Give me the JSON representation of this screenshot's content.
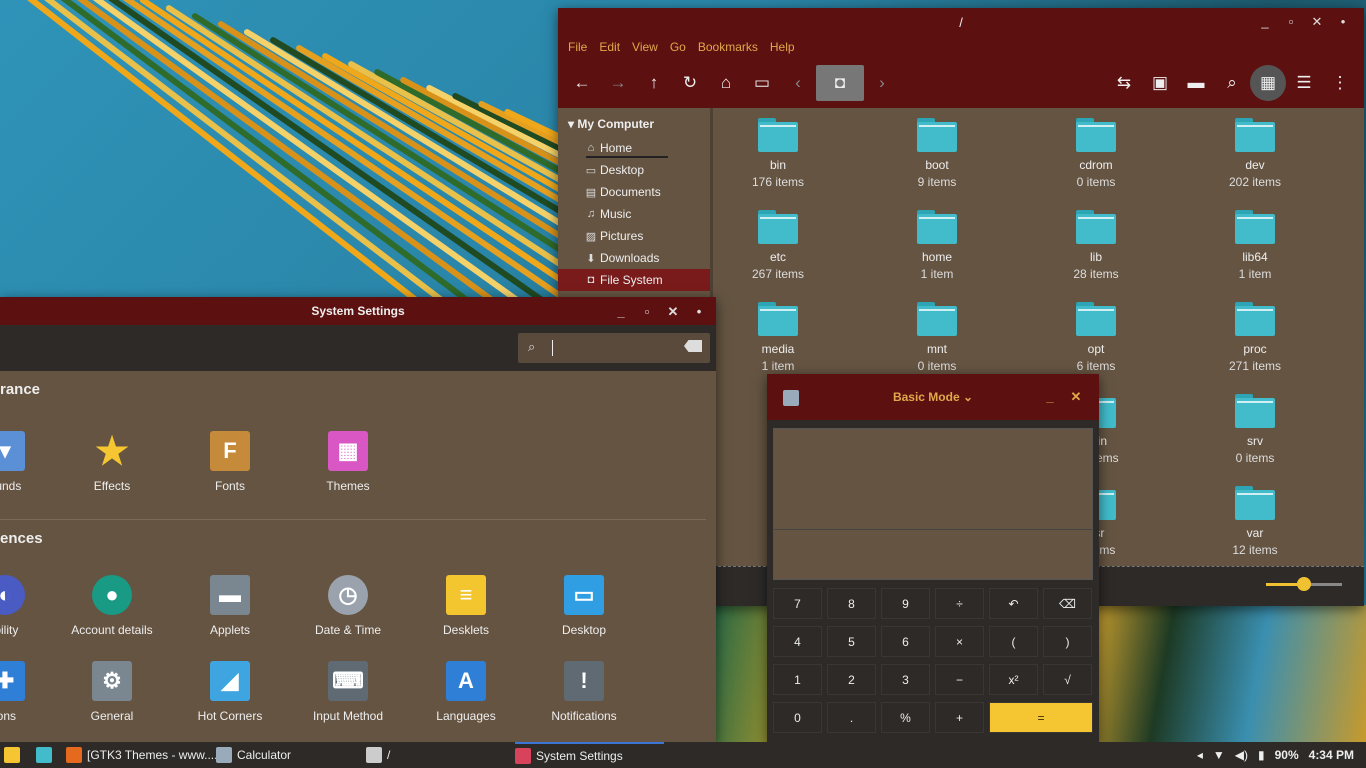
{
  "nemo": {
    "title": "/",
    "menu": [
      "File",
      "Edit",
      "View",
      "Go",
      "Bookmarks",
      "Help"
    ],
    "sidebar": {
      "header": "My Computer",
      "items": [
        {
          "label": "Home",
          "icon": "home-icon",
          "glyph": "⌂"
        },
        {
          "label": "Desktop",
          "icon": "desktop-icon",
          "glyph": "▭"
        },
        {
          "label": "Documents",
          "icon": "documents-icon",
          "glyph": "▤"
        },
        {
          "label": "Music",
          "icon": "music-icon",
          "glyph": "♫"
        },
        {
          "label": "Pictures",
          "icon": "pictures-icon",
          "glyph": "▨"
        },
        {
          "label": "Downloads",
          "icon": "downloads-icon",
          "glyph": "⬇"
        },
        {
          "label": "File System",
          "icon": "filesystem-icon",
          "glyph": "◘"
        }
      ]
    },
    "folders": [
      {
        "name": "bin",
        "count": "176 items"
      },
      {
        "name": "boot",
        "count": "9 items"
      },
      {
        "name": "cdrom",
        "count": "0 items"
      },
      {
        "name": "dev",
        "count": "202 items"
      },
      {
        "name": "etc",
        "count": "267 items"
      },
      {
        "name": "home",
        "count": "1 item"
      },
      {
        "name": "lib",
        "count": "28 items"
      },
      {
        "name": "lib64",
        "count": "1 item"
      },
      {
        "name": "media",
        "count": "1 item"
      },
      {
        "name": "mnt",
        "count": "0 items"
      },
      {
        "name": "opt",
        "count": "6 items"
      },
      {
        "name": "proc",
        "count": "271 items"
      },
      {
        "name": "",
        "count": ""
      },
      {
        "name": "",
        "count": ""
      },
      {
        "name": "sbin",
        "count": "92 items"
      },
      {
        "name": "srv",
        "count": "0 items"
      },
      {
        "name": "",
        "count": ""
      },
      {
        "name": "",
        "count": ""
      },
      {
        "name": "usr",
        "count": "8 items"
      },
      {
        "name": "var",
        "count": "12 items"
      }
    ],
    "zoom_level": 0.5
  },
  "settings": {
    "title": "System Settings",
    "sections": [
      "rance",
      "ences"
    ],
    "appearance": [
      {
        "label": "ounds",
        "icon": "backgrounds-icon",
        "glyph": "▾",
        "color": "#5b8fd6"
      },
      {
        "label": "Effects",
        "icon": "effects-star-icon",
        "glyph": "★",
        "color": "transparent"
      },
      {
        "label": "Fonts",
        "icon": "fonts-icon",
        "glyph": "F",
        "color": "#c58a3a"
      },
      {
        "label": "Themes",
        "icon": "themes-icon",
        "glyph": "▦",
        "color": "#d857c4"
      }
    ],
    "preferences_row1": [
      {
        "label": "ibility",
        "icon": "accessibility-icon",
        "glyph": "◐",
        "color": "#4a5bc4"
      },
      {
        "label": "Account details",
        "icon": "account-icon",
        "glyph": "●",
        "color": "#189a84"
      },
      {
        "label": "Applets",
        "icon": "applets-icon",
        "glyph": "▬",
        "color": "#7a8791"
      },
      {
        "label": "Date & Time",
        "icon": "clock-icon",
        "glyph": "◷",
        "color": "#9aa3ad"
      },
      {
        "label": "Desklets",
        "icon": "desklets-icon",
        "glyph": "≡",
        "color": "#f3c52e"
      },
      {
        "label": "Desktop",
        "icon": "desktop-icon",
        "glyph": "▭",
        "color": "#2f9ee3"
      }
    ],
    "preferences_row2": [
      {
        "label": "ions",
        "icon": "extensions-icon",
        "glyph": "✚",
        "color": "#2f7fd6"
      },
      {
        "label": "General",
        "icon": "gear-icon",
        "glyph": "⚙",
        "color": "#7a8791"
      },
      {
        "label": "Hot Corners",
        "icon": "hot-corners-icon",
        "glyph": "◢",
        "color": "#3fa5e0"
      },
      {
        "label": "Input Method",
        "icon": "keyboard-icon",
        "glyph": "⌨",
        "color": "#5f6a73"
      },
      {
        "label": "Languages",
        "icon": "languages-icon",
        "glyph": "A",
        "color": "#2f7fd6"
      },
      {
        "label": "Notifications",
        "icon": "notifications-icon",
        "glyph": "!",
        "color": "#5f6a73"
      }
    ]
  },
  "calculator": {
    "title": "Basic Mode",
    "keys": [
      [
        "7",
        "8",
        "9",
        "÷",
        "↶",
        "⌫"
      ],
      [
        "4",
        "5",
        "6",
        "×",
        "(",
        ")"
      ],
      [
        "1",
        "2",
        "3",
        "−",
        "x²",
        "√"
      ],
      [
        "0",
        ".",
        "%",
        "+",
        "="
      ]
    ]
  },
  "taskbar": {
    "items": [
      {
        "label": "[GTK3 Themes - www....",
        "icon": "firefox-icon",
        "color": "#e66a1e"
      },
      {
        "label": "Calculator",
        "icon": "calculator-icon",
        "color": "#9ab"
      },
      {
        "label": "/",
        "icon": "folder-icon",
        "color": "#ccc"
      },
      {
        "label": "System Settings",
        "icon": "settings-icon",
        "color": "#d8425a"
      }
    ],
    "battery": "90%",
    "time": "4:34 PM"
  },
  "colors": {
    "titlebar": "#5c1010",
    "accent": "#f5c631",
    "folder": "#42bccb",
    "menu_text": "#e0a94c"
  }
}
